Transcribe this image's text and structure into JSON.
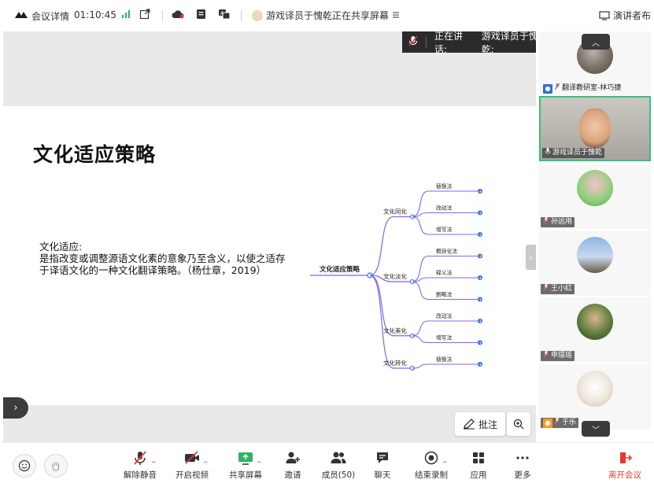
{
  "topbar": {
    "meeting_details": "会议详情",
    "timer": "01:10:45",
    "sharing_status": "游戏译员于愧乾正在共享屏幕",
    "presenter_view": "演讲者布"
  },
  "speaking_banner": {
    "label": "正在讲话:",
    "speaker": "游戏译员于愧乾;"
  },
  "slide": {
    "title": "文化适应策略",
    "definition_heading": "文化适应:",
    "definition_body": "是指改变或调整源语文化素的意象乃至含义，以使之适存于译语文化的一种文化翻译策略。（杨仕章，2019）"
  },
  "mindmap": {
    "root": "文化适应策略",
    "branches": [
      {
        "label": "文化同化",
        "leaves": [
          "替换法",
          "改动法",
          "增写法"
        ]
      },
      {
        "label": "文化淡化",
        "leaves": [
          "概括化法",
          "释义法",
          "删略法"
        ]
      },
      {
        "label": "文化美化",
        "leaves": [
          "改动法",
          "增写法"
        ]
      },
      {
        "label": "文化转化",
        "leaves": [
          "替换法"
        ]
      }
    ]
  },
  "stage_controls": {
    "annotate_label": "批注"
  },
  "participants": [
    {
      "name": "翻译教研室-林巧捷",
      "role": "host"
    },
    {
      "name": "游戏译员于愧乾",
      "role": "speaking"
    },
    {
      "name": "孙远用",
      "role": "member"
    },
    {
      "name": "王小红",
      "role": "member"
    },
    {
      "name": "申璟瑶",
      "role": "member"
    },
    {
      "name": "于乐",
      "role": "cohost"
    }
  ],
  "toolbar": {
    "mute": "解除静音",
    "video": "开启视频",
    "share": "共享屏幕",
    "invite": "邀请",
    "members": "成员(50)",
    "chat": "聊天",
    "stop_record": "结束录制",
    "apps": "应用",
    "more": "更多",
    "leave": "离开会议"
  },
  "colors": {
    "accent_blue": "#2e6ee0",
    "leave_red": "#e53935",
    "mindmap_line": "#7b68ee",
    "active_border": "#35c07a"
  }
}
